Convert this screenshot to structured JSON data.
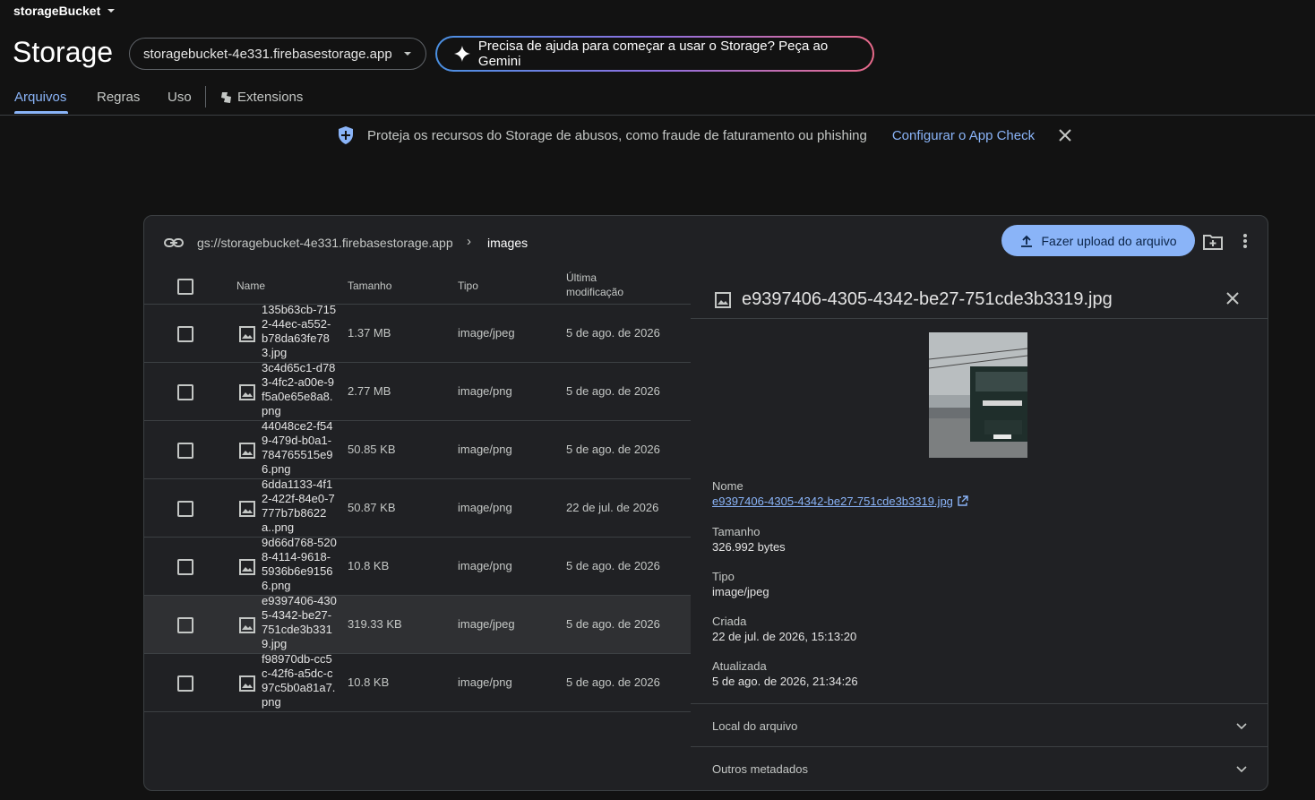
{
  "header": {
    "project_name": "storageBucket",
    "title": "Storage",
    "bucket": "storagebucket-4e331.firebasestorage.app",
    "gemini_prompt": "Precisa de ajuda para começar a usar o Storage? Peça ao Gemini"
  },
  "tabs": [
    {
      "label": "Arquivos",
      "active": true
    },
    {
      "label": "Regras"
    },
    {
      "label": "Uso"
    },
    {
      "label": "Extensions"
    }
  ],
  "banner": {
    "text": "Proteja os recursos do Storage de abusos, como fraude de faturamento ou phishing",
    "link": "Configurar o App Check"
  },
  "path": {
    "root": "gs://storagebucket-4e331.firebasestorage.app",
    "folder": "images"
  },
  "upload_label": "Fazer upload do arquivo",
  "table": {
    "headers": {
      "name": "Name",
      "size": "Tamanho",
      "type": "Tipo",
      "modified_line1": "Última",
      "modified_line2": "modificação"
    },
    "rows": [
      {
        "name": "135b63cb-7152-44ec-a552-b78da63fe783.jpg",
        "size": "1.37 MB",
        "type": "image/jpeg",
        "modified": "5 de ago. de 2026"
      },
      {
        "name": "3c4d65c1-d783-4fc2-a00e-9f5a0e65e8a8.png",
        "size": "2.77 MB",
        "type": "image/png",
        "modified": "5 de ago. de 2026"
      },
      {
        "name": "44048ce2-f549-479d-b0a1-784765515e96.png",
        "size": "50.85 KB",
        "type": "image/png",
        "modified": "5 de ago. de 2026"
      },
      {
        "name": "6dda1133-4f12-422f-84e0-7777b7b8622a..png",
        "size": "50.87 KB",
        "type": "image/png",
        "modified": "22 de jul. de 2026"
      },
      {
        "name": "9d66d768-5208-4114-9618-5936b6e91566.png",
        "size": "10.8 KB",
        "type": "image/png",
        "modified": "5 de ago. de 2026"
      },
      {
        "name": "e9397406-4305-4342-be27-751cde3b3319.jpg",
        "size": "319.33 KB",
        "type": "image/jpeg",
        "modified": "5 de ago. de 2026",
        "selected": true
      },
      {
        "name": "f98970db-cc5c-42f6-a5dc-c97c5b0a81a7.png",
        "size": "10.8 KB",
        "type": "image/png",
        "modified": "5 de ago. de 2026"
      }
    ]
  },
  "details": {
    "title": "e9397406-4305-4342-be27-751cde3b3319.jpg",
    "fields": [
      {
        "label": "Nome",
        "value": "e9397406-4305-4342-be27-751cde3b3319.jpg"
      },
      {
        "label": "Tamanho",
        "value": "326.992 bytes"
      },
      {
        "label": "Tipo",
        "value": "image/jpeg"
      },
      {
        "label": "Criada",
        "value": "22 de jul. de 2026, 15:13:20"
      },
      {
        "label": "Atualizada",
        "value": "5 de ago. de 2026, 21:34:26"
      }
    ],
    "sections": [
      {
        "label": "Local do arquivo"
      },
      {
        "label": "Outros metadados"
      }
    ]
  },
  "colors": {
    "accent": "#8ab4f8",
    "background": "#121212",
    "panel": "#202124"
  }
}
